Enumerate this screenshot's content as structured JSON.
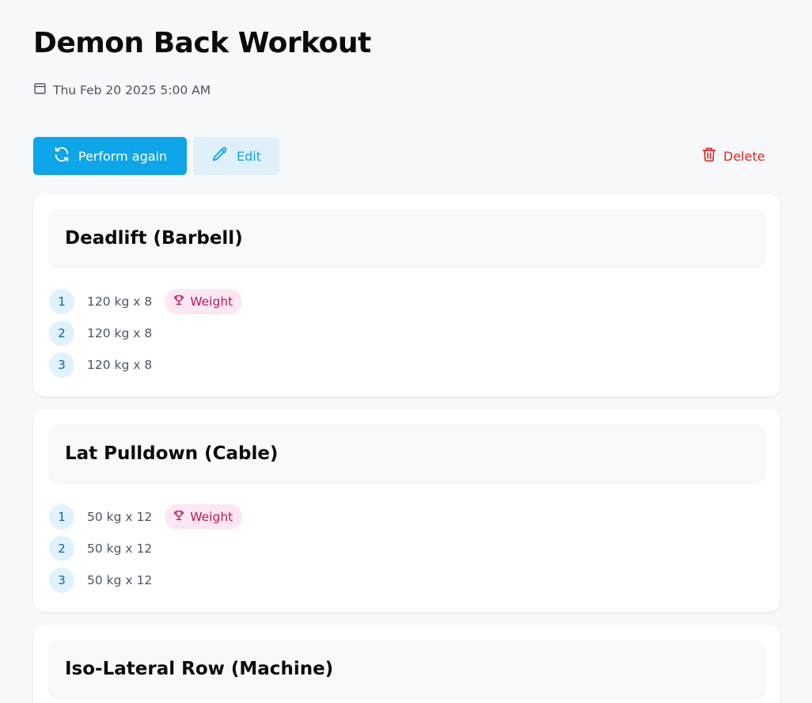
{
  "workout": {
    "title": "Demon Back Workout",
    "date": "Thu Feb 20 2025 5:00 AM"
  },
  "actions": {
    "perform_again": "Perform again",
    "edit": "Edit",
    "delete": "Delete"
  },
  "colors": {
    "primary": "#0ea5e9",
    "danger": "#dc2626",
    "badge_text": "#be185d",
    "badge_bg": "#fce7f3"
  },
  "exercises": [
    {
      "name": "Deadlift (Barbell)",
      "sets": [
        {
          "num": "1",
          "value": "120 kg x 8",
          "badge": "Weight"
        },
        {
          "num": "2",
          "value": "120 kg x 8"
        },
        {
          "num": "3",
          "value": "120 kg x 8"
        }
      ]
    },
    {
      "name": "Lat Pulldown (Cable)",
      "sets": [
        {
          "num": "1",
          "value": "50 kg x 12",
          "badge": "Weight"
        },
        {
          "num": "2",
          "value": "50 kg x 12"
        },
        {
          "num": "3",
          "value": "50 kg x 12"
        }
      ]
    },
    {
      "name": "Iso-Lateral Row (Machine)",
      "sets": []
    }
  ],
  "icons": {
    "date": "calendar-icon",
    "perform_again": "refresh-icon",
    "edit": "pencil-icon",
    "delete": "trash-icon",
    "badge": "trophy-icon"
  }
}
